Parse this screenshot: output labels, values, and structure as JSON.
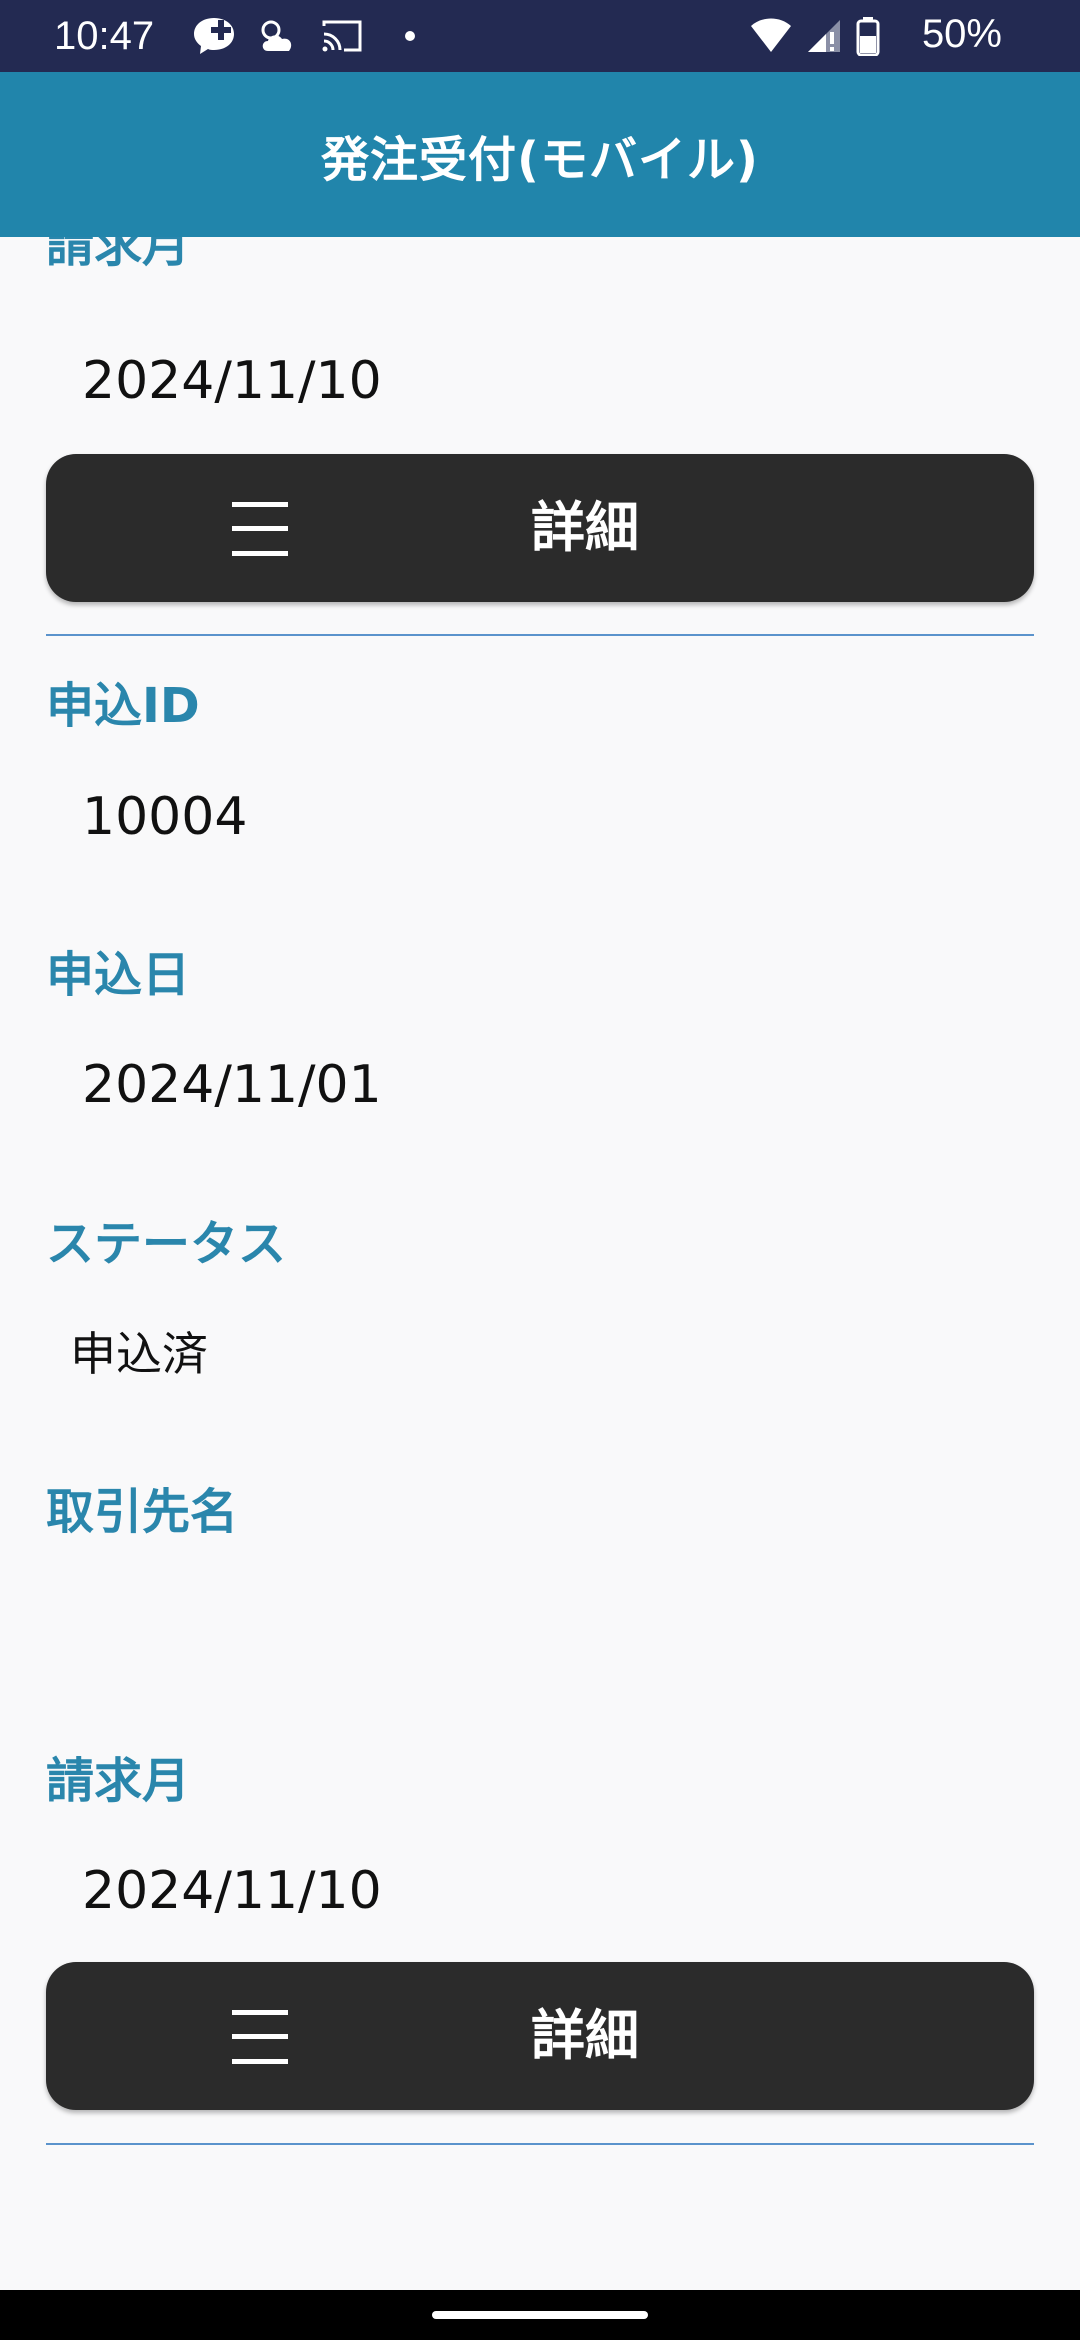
{
  "status_bar": {
    "time": "10:47",
    "battery": "50%",
    "left_icons": [
      "messenger-plus-icon",
      "weather-icon",
      "cast-icon",
      "dot-icon"
    ],
    "right_icons": [
      "wifi-icon",
      "signal-icon",
      "battery-icon"
    ]
  },
  "app_bar": {
    "title": "発注受付(モバイル)"
  },
  "records": [
    {
      "billing_month_label": "請求月",
      "billing_month": "2024/11/10",
      "detail_label": "詳細"
    },
    {
      "application_id_label": "申込ID",
      "application_id": "10004",
      "application_date_label": "申込日",
      "application_date": "2024/11/01",
      "status_label": "ステータス",
      "status": "申込済",
      "client_name_label": "取引先名",
      "client_name": "",
      "billing_month_label": "請求月",
      "billing_month": "2024/11/10",
      "detail_label": "詳細"
    }
  ],
  "colors": {
    "status_bar": "#232a52",
    "app_bar": "#2185ab",
    "label": "#2a86ac",
    "button": "#2b2b2b",
    "divider": "#5b93cc",
    "background": "#f9f9fa"
  }
}
